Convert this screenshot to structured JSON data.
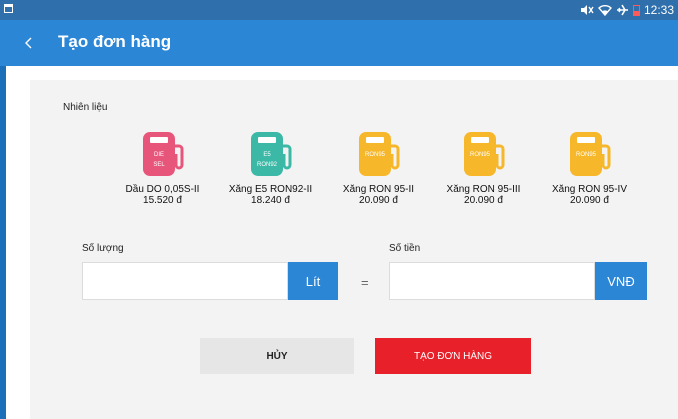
{
  "status_bar": {
    "time": "12:33"
  },
  "app_bar": {
    "title": "Tạo đơn hàng",
    "back_icon": "chevron-left-icon"
  },
  "form": {
    "fuel_label": "Nhiên liệu",
    "fuels": [
      {
        "pump_text_1": "DIE",
        "pump_text_2": "SEL",
        "name": "Dầu DO 0,05S-II",
        "price": "15.520 đ",
        "color": "#e8557a"
      },
      {
        "pump_text_1": "E5",
        "pump_text_2": "RON92",
        "name": "Xăng E5 RON92-II",
        "price": "18.240 đ",
        "color": "#3cb8a6"
      },
      {
        "pump_text_1": "RON95",
        "pump_text_2": "",
        "name": "Xăng RON 95-II",
        "price": "20.090 đ",
        "color": "#f6b72b"
      },
      {
        "pump_text_1": "RON95",
        "pump_text_2": "",
        "name": "Xăng RON 95-III",
        "price": "20.090 đ",
        "color": "#f6b72b"
      },
      {
        "pump_text_1": "RON95",
        "pump_text_2": "",
        "name": "Xăng RON 95-IV",
        "price": "20.090 đ",
        "color": "#f6b72b"
      }
    ],
    "quantity_label": "Số lượng",
    "quantity_unit": "Lít",
    "equals": "=",
    "amount_label": "Số tiền",
    "amount_unit": "VNĐ",
    "cancel_label": "HỦY",
    "create_label": "TẠO ĐƠN HÀNG"
  },
  "colors": {
    "primary": "#2b86d6",
    "danger": "#e8202a",
    "status_bar": "#2f6fab"
  }
}
